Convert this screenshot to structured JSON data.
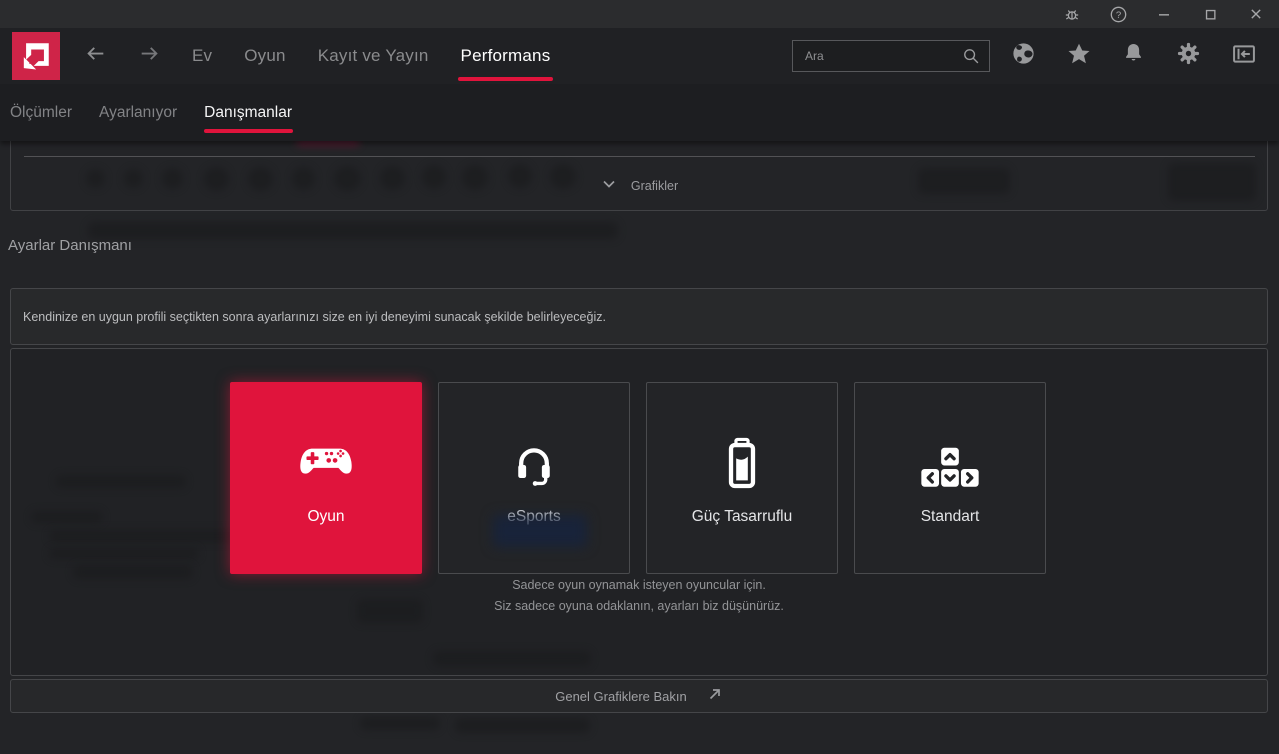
{
  "colors": {
    "accent_red": "#e0143c",
    "logo_red": "#cf2448",
    "titlebar_bg": "#2b2c2e",
    "navbar_bg": "#202124",
    "subnav_bg": "#1d1e21",
    "content_bg": "#232427",
    "panel_bg": "#28292b",
    "panel_border": "#454649",
    "muted_text": "#9c9da0"
  },
  "titlebar": {
    "icons": [
      "bug-report",
      "help",
      "minimize",
      "maximize",
      "close"
    ]
  },
  "navbar": {
    "tabs": [
      {
        "label": "Ev",
        "active": false
      },
      {
        "label": "Oyun",
        "active": false
      },
      {
        "label": "Kayıt ve Yayın",
        "active": false
      },
      {
        "label": "Performans",
        "active": true
      }
    ],
    "search_placeholder": "Ara",
    "icons": [
      "globe",
      "favorites-star",
      "notifications-bell",
      "settings-gear",
      "dock-panel"
    ]
  },
  "subnav": {
    "tabs": [
      {
        "label": "Ölçümler",
        "active": false
      },
      {
        "label": "Ayarlanıyor",
        "active": false
      },
      {
        "label": "Danışmanlar",
        "active": true
      }
    ]
  },
  "graphics_panel": {
    "label": "Grafikler",
    "state": "collapsed"
  },
  "advisor": {
    "title": "Ayarlar Danışmanı",
    "intro": "Kendinize en uygun profili seçtikten sonra ayarlarınızı size en iyi deneyimi sunacak şekilde belirleyeceğiz.",
    "profiles": [
      {
        "label": "Oyun",
        "icon": "gamepad",
        "selected": true
      },
      {
        "label": "eSports",
        "icon": "headset",
        "selected": false
      },
      {
        "label": "Güç Tasarruflu",
        "icon": "battery",
        "selected": false
      },
      {
        "label": "Standart",
        "icon": "arrow-keys",
        "selected": false
      }
    ],
    "profile_description": [
      "Sadece oyun oynamak isteyen oyuncular için.",
      "Siz sadece oyuna odaklanın, ayarları biz düşünürüz."
    ],
    "footer_link": "Genel Grafiklere Bakın"
  }
}
